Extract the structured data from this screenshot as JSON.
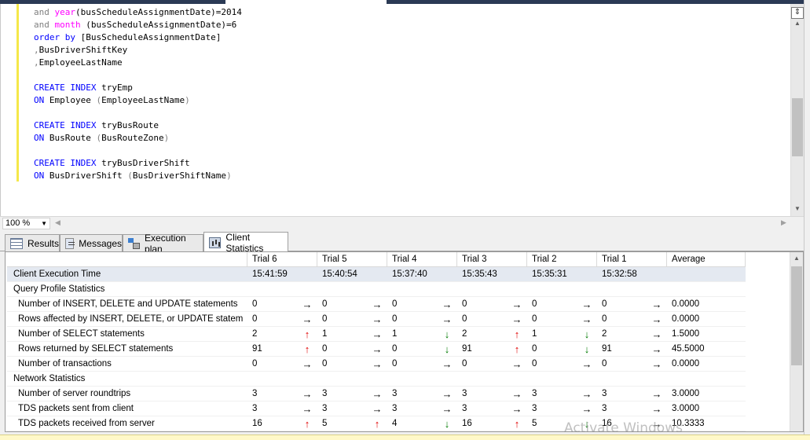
{
  "editor": {
    "lines": [
      {
        "parts": [
          {
            "t": "and ",
            "c": "op"
          },
          {
            "t": "year",
            "c": "fn"
          },
          {
            "t": "(busScheduleAssignmentDate)=2014",
            "c": ""
          }
        ]
      },
      {
        "parts": [
          {
            "t": "and ",
            "c": "op"
          },
          {
            "t": "month ",
            "c": "fn"
          },
          {
            "t": "(busScheduleAssignmentDate)=6",
            "c": ""
          }
        ]
      },
      {
        "parts": [
          {
            "t": "order by ",
            "c": "kw"
          },
          {
            "t": "[BusScheduleAssignmentDate]",
            "c": ""
          }
        ]
      },
      {
        "parts": [
          {
            "t": ",",
            "c": "op"
          },
          {
            "t": "BusDriverShiftKey",
            "c": ""
          }
        ]
      },
      {
        "parts": [
          {
            "t": ",",
            "c": "op"
          },
          {
            "t": "EmployeeLastName",
            "c": ""
          }
        ]
      },
      {
        "parts": []
      },
      {
        "parts": [
          {
            "t": "CREATE INDEX ",
            "c": "kw"
          },
          {
            "t": "tryEmp",
            "c": ""
          }
        ]
      },
      {
        "parts": [
          {
            "t": "ON ",
            "c": "kw"
          },
          {
            "t": "Employee ",
            "c": ""
          },
          {
            "t": "(",
            "c": "op"
          },
          {
            "t": "EmployeeLastName",
            "c": ""
          },
          {
            "t": ")",
            "c": "op"
          }
        ]
      },
      {
        "parts": []
      },
      {
        "parts": [
          {
            "t": "CREATE INDEX ",
            "c": "kw"
          },
          {
            "t": "tryBusRoute",
            "c": ""
          }
        ]
      },
      {
        "parts": [
          {
            "t": "ON ",
            "c": "kw"
          },
          {
            "t": "BusRoute ",
            "c": ""
          },
          {
            "t": "(",
            "c": "op"
          },
          {
            "t": "BusRouteZone",
            "c": ""
          },
          {
            "t": ")",
            "c": "op"
          }
        ]
      },
      {
        "parts": []
      },
      {
        "parts": [
          {
            "t": "CREATE INDEX ",
            "c": "kw"
          },
          {
            "t": "tryBusDriverShift",
            "c": ""
          }
        ]
      },
      {
        "parts": [
          {
            "t": "ON ",
            "c": "kw"
          },
          {
            "t": "BusDriverShift ",
            "c": ""
          },
          {
            "t": "(",
            "c": "op"
          },
          {
            "t": "BusDriverShiftName",
            "c": ""
          },
          {
            "t": ")",
            "c": "op"
          }
        ]
      }
    ]
  },
  "zoom": {
    "value": "100 %"
  },
  "tabs": [
    {
      "label": "Results",
      "icon": "grid-icon",
      "active": false
    },
    {
      "label": "Messages",
      "icon": "messages-icon",
      "active": false
    },
    {
      "label": "Execution plan",
      "icon": "execution-plan-icon",
      "active": false
    },
    {
      "label": "Client Statistics",
      "icon": "client-statistics-icon",
      "active": true
    }
  ],
  "stats": {
    "columns": [
      "Trial 6",
      "Trial 5",
      "Trial 4",
      "Trial 3",
      "Trial 2",
      "Trial 1",
      "Average"
    ],
    "rows": [
      {
        "kind": "exec",
        "label": "Client Execution Time",
        "values": [
          "15:41:59",
          "15:40:54",
          "15:37:40",
          "15:35:43",
          "15:35:31",
          "15:32:58",
          ""
        ],
        "arrows": []
      },
      {
        "kind": "section",
        "label": "Query Profile Statistics",
        "values": [],
        "arrows": []
      },
      {
        "kind": "data",
        "label": "Number of INSERT, DELETE and UPDATE statements",
        "values": [
          "0",
          "0",
          "0",
          "0",
          "0",
          "0",
          "0.0000"
        ],
        "arrows": [
          "eq",
          "eq",
          "eq",
          "eq",
          "eq",
          "eq"
        ]
      },
      {
        "kind": "data",
        "label": "Rows affected by INSERT, DELETE, or UPDATE statem...",
        "values": [
          "0",
          "0",
          "0",
          "0",
          "0",
          "0",
          "0.0000"
        ],
        "arrows": [
          "eq",
          "eq",
          "eq",
          "eq",
          "eq",
          "eq"
        ]
      },
      {
        "kind": "data",
        "label": "Number of SELECT statements",
        "values": [
          "2",
          "1",
          "1",
          "2",
          "1",
          "2",
          "1.5000"
        ],
        "arrows": [
          "up",
          "eq",
          "down",
          "up",
          "down",
          "eq"
        ]
      },
      {
        "kind": "data",
        "label": "Rows returned by SELECT statements",
        "values": [
          "91",
          "0",
          "0",
          "91",
          "0",
          "91",
          "45.5000"
        ],
        "arrows": [
          "up",
          "eq",
          "down",
          "up",
          "down",
          "eq"
        ]
      },
      {
        "kind": "data",
        "label": "Number of transactions",
        "values": [
          "0",
          "0",
          "0",
          "0",
          "0",
          "0",
          "0.0000"
        ],
        "arrows": [
          "eq",
          "eq",
          "eq",
          "eq",
          "eq",
          "eq"
        ]
      },
      {
        "kind": "section",
        "label": "Network Statistics",
        "values": [],
        "arrows": []
      },
      {
        "kind": "data",
        "label": "Number of server roundtrips",
        "values": [
          "3",
          "3",
          "3",
          "3",
          "3",
          "3",
          "3.0000"
        ],
        "arrows": [
          "eq",
          "eq",
          "eq",
          "eq",
          "eq",
          "eq"
        ]
      },
      {
        "kind": "data",
        "label": "TDS packets sent from client",
        "values": [
          "3",
          "3",
          "3",
          "3",
          "3",
          "3",
          "3.0000"
        ],
        "arrows": [
          "eq",
          "eq",
          "eq",
          "eq",
          "eq",
          "eq"
        ]
      },
      {
        "kind": "data",
        "label": "TDS packets received from server",
        "values": [
          "16",
          "5",
          "4",
          "16",
          "5",
          "16",
          "10.3333"
        ],
        "arrows": [
          "up",
          "up",
          "down",
          "up",
          "down",
          "eq"
        ]
      }
    ]
  },
  "arrow_glyphs": {
    "eq": "→",
    "up": "↑",
    "down": "↓"
  },
  "colors": {
    "keyword": "#0000ff",
    "function": "#ff00ff",
    "arrow_up": "#e00000",
    "arrow_down": "#007a00"
  },
  "watermark": "Activate Windows"
}
